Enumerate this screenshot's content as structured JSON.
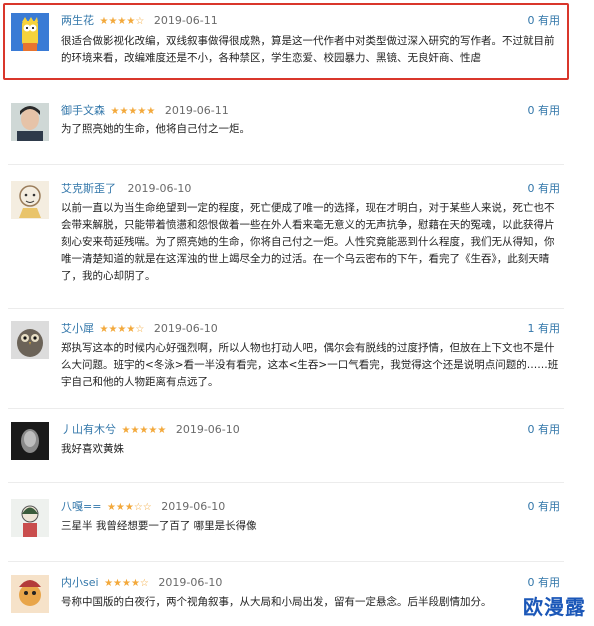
{
  "reviews": [
    {
      "author": "两生花",
      "stars": "★★★★☆",
      "date": "2019-06-11",
      "useful": "0 有用",
      "lines": [
        "很适合做影视化改编，双线叙事做得很成熟，算是这一代作者中对类型做过深入研究的写作者。不过就目前",
        "的环境来看，改编难度还是不小，各种禁区，学生恋爱、校园暴力、黑镜、无良奸商、性虐"
      ]
    },
    {
      "author": "御手文森",
      "stars": "★★★★★",
      "date": "2019-06-11",
      "useful": "0 有用",
      "lines": [
        "为了照亮她的生命，他将自己付之一炬。"
      ]
    },
    {
      "author": "艾克斯歪了",
      "stars": "",
      "date": "2019-06-10",
      "useful": "0 有用",
      "lines": [
        "以前一直以为当生命绝望到一定的程度，死亡便成了唯一的选择，现在才明白，对于某些人来说，死亡也不",
        "会带来解脱，只能带着愤懑和怨恨做着一些在外人看来毫无意义的无声抗争，慰藉在天的冤魂，以此获得片",
        "刻心安来苟延残喘。为了照亮她的生命，你将自己付之一炬。人性究竟能恶到什么程度，我们无从得知，你",
        "唯一清楚知道的就是在这浑浊的世上竭尽全力的过活。在一个乌云密布的下午，看完了《生吞》，此刻天晴",
        "了，我的心却阴了。"
      ]
    },
    {
      "author": "艾小犀",
      "stars": "★★★★☆",
      "date": "2019-06-10",
      "useful": "1 有用",
      "lines": [
        "郑执写这本的时候内心好强烈啊，所以人物也打动人吧，偶尔会有脱线的过度抒情，但放在上下文也不是什",
        "么大问题。班宇的<冬泳>看一半没有看完，这本<生吞>一口气看完，我觉得这个还是说明点问题的……班",
        "宇自己和他的人物距离有点远了。"
      ]
    },
    {
      "author": "丿山有木兮",
      "stars": "★★★★★",
      "date": "2019-06-10",
      "useful": "0 有用",
      "lines": [
        "我好喜欢黄姝"
      ]
    },
    {
      "author": "八嘎==",
      "stars": "★★★☆☆",
      "date": "2019-06-10",
      "useful": "0 有用",
      "lines": [
        "三星半 我曾经想要一了百了 哪里是长得像"
      ]
    },
    {
      "author": "内小sei",
      "stars": "★★★★☆",
      "date": "2019-06-10",
      "useful": "0 有用",
      "lines": [
        "号称中国版的白夜行，两个视角叙事，从大局和小局出发，留有一定悬念。后半段剧情加分。"
      ]
    }
  ],
  "watermark": "欧漫露",
  "colors": {
    "author": "#3377aa",
    "star": "#f3a93c",
    "highlight": "#d9362b",
    "watermark": "#1b57b8"
  }
}
